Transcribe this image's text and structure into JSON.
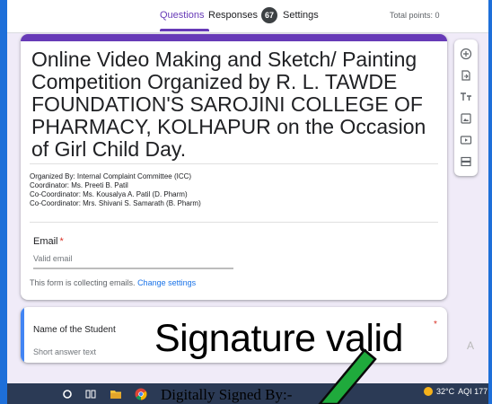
{
  "tabs": [
    {
      "label": "Questions"
    },
    {
      "label": "Responses"
    },
    {
      "label": "Settings"
    }
  ],
  "responses_count": "67",
  "total_points": "Total points: 0",
  "form": {
    "title": "Online Video Making and Sketch/ Painting Competition Organized  by R. L. TAWDE FOUNDATION'S SAROJINI COLLEGE OF PHARMACY, KOLHAPUR on the Occasion of Girl Child Day.",
    "description_lines": [
      "Organized By: Internal Complaint Committee (ICC)",
      "Coordinator: Ms. Preeti B. Patil",
      "Co-Coordinator: Ms. Kousalya A. Patil (D. Pharm)",
      "Co-Coordinator: Mrs. Shivani S. Samarath (B. Pharm)"
    ],
    "email_label": "Email",
    "required_mark": "*",
    "email_placeholder": "Valid email",
    "collect_note": "This form is collecting emails.",
    "change_settings": "Change settings"
  },
  "toolbar": {
    "icons": [
      "add-question-icon",
      "import-questions-icon",
      "add-title-icon",
      "add-image-icon",
      "add-video-icon",
      "add-section-icon"
    ]
  },
  "question": {
    "title": "Name of the Student",
    "required_mark": "*",
    "placeholder": "Short answer text"
  },
  "overlay": {
    "signature_valid": "Signature valid",
    "ghost_text": "A",
    "digitally_signed": "Digitally Signed By:-"
  },
  "taskbar": {
    "temperature": "32°C",
    "aqi": "AQI 177"
  },
  "colors": {
    "accent": "#673ab7",
    "question_bar": "#4285f4",
    "required": "#d93025",
    "link": "#1a73e8",
    "taskbar": "#2b3a55",
    "check_green": "#1faa3c"
  }
}
